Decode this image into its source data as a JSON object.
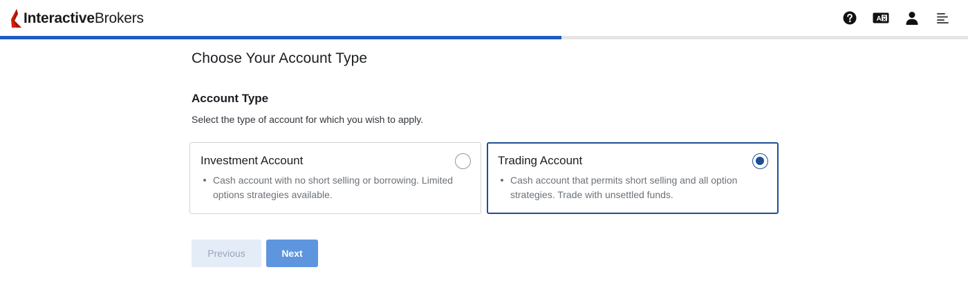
{
  "brand": {
    "name_bold": "Interactive",
    "name_light": "Brokers",
    "accent_color": "#d81e05"
  },
  "header": {
    "icons": [
      "help-icon",
      "language-icon",
      "user-icon",
      "menu-icon"
    ],
    "language_icon_text": "A",
    "progress_percent": 58,
    "progress_color": "#1f5bc1"
  },
  "main": {
    "title": "Choose Your Account Type",
    "section_title": "Account Type",
    "section_desc": "Select the type of account for which you wish to apply.",
    "options": [
      {
        "title": "Investment Account",
        "description": "Cash account with no short selling or borrowing. Limited options strategies available.",
        "selected": false
      },
      {
        "title": "Trading Account",
        "description": "Cash account that permits short selling and all option strategies. Trade with unsettled funds.",
        "selected": true
      }
    ],
    "selected_color": "#1b4f94"
  },
  "buttons": {
    "previous_label": "Previous",
    "next_label": "Next",
    "next_color": "#5d95df"
  }
}
